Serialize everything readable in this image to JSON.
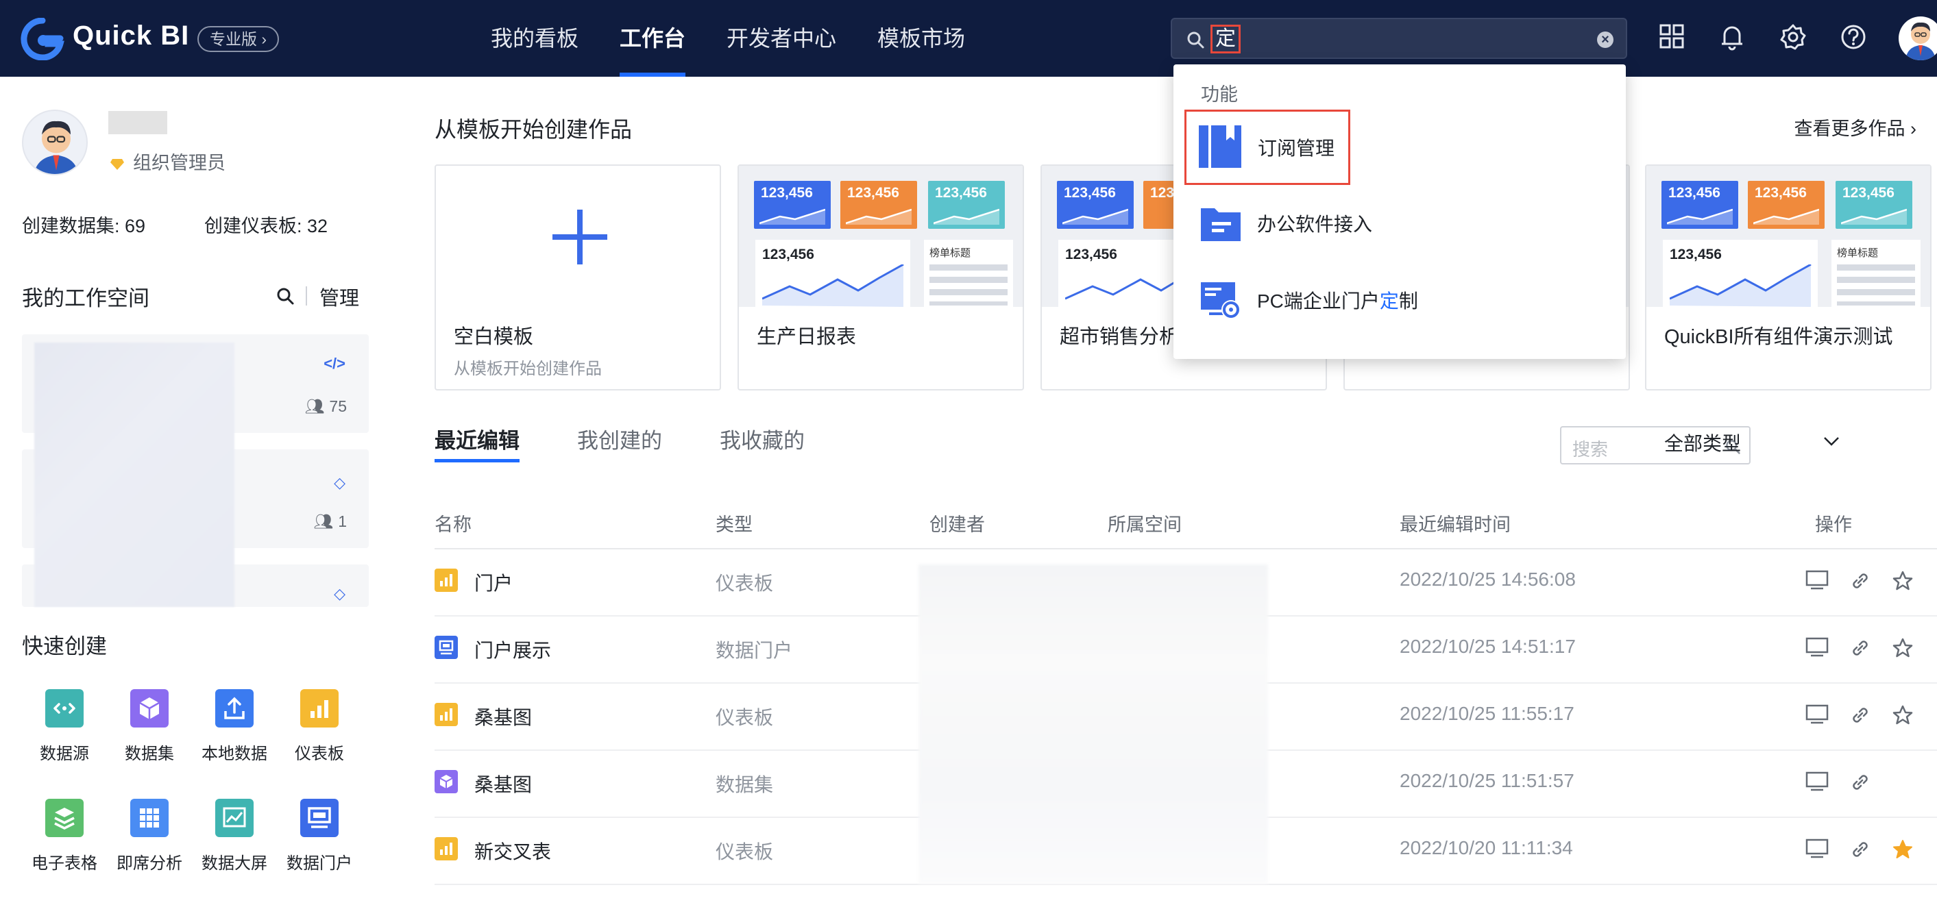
{
  "app": {
    "name": "Quick BI",
    "edition": "专业版"
  },
  "nav": [
    {
      "label": "我的看板",
      "active": false
    },
    {
      "label": "工作台",
      "active": true
    },
    {
      "label": "开发者中心",
      "active": false
    },
    {
      "label": "模板市场",
      "active": false
    }
  ],
  "search": {
    "value": "定",
    "clear_icon": "close-circle-icon"
  },
  "dropdown": {
    "group_label": "功能",
    "items": [
      {
        "label": "订阅管理",
        "icon": "bookmark-icon"
      },
      {
        "label": "办公软件接入",
        "icon": "folder-doc-icon"
      },
      {
        "label_pre": "PC端企业门户",
        "label_mark": "定",
        "label_post": "制",
        "icon": "portal-settings-icon"
      }
    ]
  },
  "user": {
    "role": "组织管理员",
    "datasets_created": "创建数据集: 69",
    "dashboards_created": "创建仪表板: 32"
  },
  "workspace": {
    "title": "我的工作空间",
    "manage_label": "管理",
    "cards": [
      {
        "icon": "code-icon",
        "members": "75"
      },
      {
        "icon": "diamond-icon",
        "members": "1"
      },
      {
        "icon": "diamond-icon",
        "members": ""
      }
    ]
  },
  "quick_create": {
    "title": "快速创建",
    "items": [
      {
        "label": "数据源",
        "color": "#3fb4b1"
      },
      {
        "label": "数据集",
        "color": "#8b6cf0"
      },
      {
        "label": "本地数据",
        "color": "#3b7bf0"
      },
      {
        "label": "仪表板",
        "color": "#f5b931"
      },
      {
        "label": "电子表格",
        "color": "#5bbf6d"
      },
      {
        "label": "即席分析",
        "color": "#4a8cf3"
      },
      {
        "label": "数据大屏",
        "color": "#3fb4b1"
      },
      {
        "label": "数据门户",
        "color": "#3b6be8"
      }
    ]
  },
  "templates": {
    "section_title": "从模板开始创建作品",
    "more_label": "查看更多作品",
    "thumb": {
      "kpi": "123,456",
      "list_title": "榜单标题"
    },
    "cards": [
      {
        "name": "空白模板",
        "sub": "从模板开始创建作品"
      },
      {
        "name": "生产日报表",
        "sub": ""
      },
      {
        "name": "超市销售分析",
        "sub": ""
      },
      {
        "name": "",
        "sub": ""
      },
      {
        "name": "QuickBI所有组件演示测试",
        "sub": ""
      }
    ]
  },
  "tabs": [
    {
      "label": "最近编辑",
      "active": true
    },
    {
      "label": "我创建的",
      "active": false
    },
    {
      "label": "我收藏的",
      "active": false
    }
  ],
  "table_search": {
    "placeholder": "搜索"
  },
  "filter": {
    "label": "全部类型"
  },
  "table": {
    "columns": [
      "名称",
      "类型",
      "创建者",
      "所属空间",
      "最近编辑时间",
      "操作"
    ],
    "rows": [
      {
        "name": "门户",
        "type": "仪表板",
        "time": "2022/10/25 14:56:08",
        "type_icon": "dashboard-icon",
        "starred": false
      },
      {
        "name": "门户展示",
        "type": "数据门户",
        "time": "2022/10/25 14:51:17",
        "type_icon": "portal-icon",
        "starred": false
      },
      {
        "name": "桑基图",
        "type": "仪表板",
        "time": "2022/10/25 11:55:17",
        "type_icon": "dashboard-icon",
        "starred": false
      },
      {
        "name": "桑基图",
        "type": "数据集",
        "time": "2022/10/25 11:51:57",
        "type_icon": "dataset-icon",
        "starred": null
      },
      {
        "name": "新交叉表",
        "type": "仪表板",
        "time": "2022/10/20 11:11:34",
        "type_icon": "dashboard-icon",
        "starred": true
      }
    ]
  },
  "colors": {
    "accent": "#1f6bff",
    "topbar": "#0f1c3f",
    "highlight": "#e8483b",
    "star": "#f5a623",
    "tile_blue": "#3b6be8",
    "tile_orange": "#f08a3c",
    "tile_teal": "#5bc3cc"
  }
}
